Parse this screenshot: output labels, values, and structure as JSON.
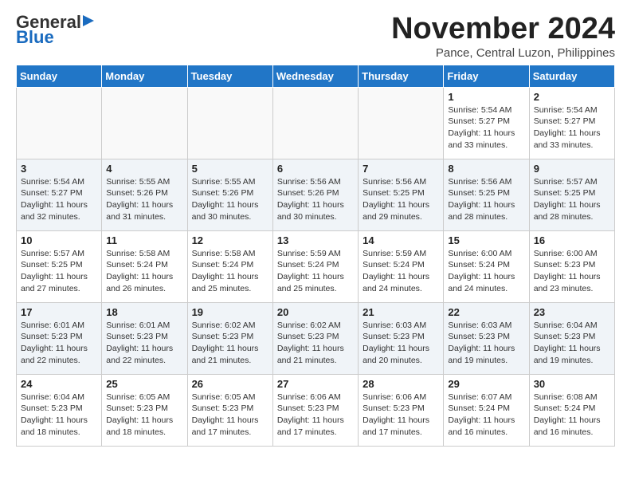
{
  "header": {
    "logo_general": "General",
    "logo_blue": "Blue",
    "month_title": "November 2024",
    "location": "Pance, Central Luzon, Philippines"
  },
  "weekdays": [
    "Sunday",
    "Monday",
    "Tuesday",
    "Wednesday",
    "Thursday",
    "Friday",
    "Saturday"
  ],
  "weeks": [
    [
      {
        "day": "",
        "info": ""
      },
      {
        "day": "",
        "info": ""
      },
      {
        "day": "",
        "info": ""
      },
      {
        "day": "",
        "info": ""
      },
      {
        "day": "",
        "info": ""
      },
      {
        "day": "1",
        "info": "Sunrise: 5:54 AM\nSunset: 5:27 PM\nDaylight: 11 hours\nand 33 minutes."
      },
      {
        "day": "2",
        "info": "Sunrise: 5:54 AM\nSunset: 5:27 PM\nDaylight: 11 hours\nand 33 minutes."
      }
    ],
    [
      {
        "day": "3",
        "info": "Sunrise: 5:54 AM\nSunset: 5:27 PM\nDaylight: 11 hours\nand 32 minutes."
      },
      {
        "day": "4",
        "info": "Sunrise: 5:55 AM\nSunset: 5:26 PM\nDaylight: 11 hours\nand 31 minutes."
      },
      {
        "day": "5",
        "info": "Sunrise: 5:55 AM\nSunset: 5:26 PM\nDaylight: 11 hours\nand 30 minutes."
      },
      {
        "day": "6",
        "info": "Sunrise: 5:56 AM\nSunset: 5:26 PM\nDaylight: 11 hours\nand 30 minutes."
      },
      {
        "day": "7",
        "info": "Sunrise: 5:56 AM\nSunset: 5:25 PM\nDaylight: 11 hours\nand 29 minutes."
      },
      {
        "day": "8",
        "info": "Sunrise: 5:56 AM\nSunset: 5:25 PM\nDaylight: 11 hours\nand 28 minutes."
      },
      {
        "day": "9",
        "info": "Sunrise: 5:57 AM\nSunset: 5:25 PM\nDaylight: 11 hours\nand 28 minutes."
      }
    ],
    [
      {
        "day": "10",
        "info": "Sunrise: 5:57 AM\nSunset: 5:25 PM\nDaylight: 11 hours\nand 27 minutes."
      },
      {
        "day": "11",
        "info": "Sunrise: 5:58 AM\nSunset: 5:24 PM\nDaylight: 11 hours\nand 26 minutes."
      },
      {
        "day": "12",
        "info": "Sunrise: 5:58 AM\nSunset: 5:24 PM\nDaylight: 11 hours\nand 25 minutes."
      },
      {
        "day": "13",
        "info": "Sunrise: 5:59 AM\nSunset: 5:24 PM\nDaylight: 11 hours\nand 25 minutes."
      },
      {
        "day": "14",
        "info": "Sunrise: 5:59 AM\nSunset: 5:24 PM\nDaylight: 11 hours\nand 24 minutes."
      },
      {
        "day": "15",
        "info": "Sunrise: 6:00 AM\nSunset: 5:24 PM\nDaylight: 11 hours\nand 24 minutes."
      },
      {
        "day": "16",
        "info": "Sunrise: 6:00 AM\nSunset: 5:23 PM\nDaylight: 11 hours\nand 23 minutes."
      }
    ],
    [
      {
        "day": "17",
        "info": "Sunrise: 6:01 AM\nSunset: 5:23 PM\nDaylight: 11 hours\nand 22 minutes."
      },
      {
        "day": "18",
        "info": "Sunrise: 6:01 AM\nSunset: 5:23 PM\nDaylight: 11 hours\nand 22 minutes."
      },
      {
        "day": "19",
        "info": "Sunrise: 6:02 AM\nSunset: 5:23 PM\nDaylight: 11 hours\nand 21 minutes."
      },
      {
        "day": "20",
        "info": "Sunrise: 6:02 AM\nSunset: 5:23 PM\nDaylight: 11 hours\nand 21 minutes."
      },
      {
        "day": "21",
        "info": "Sunrise: 6:03 AM\nSunset: 5:23 PM\nDaylight: 11 hours\nand 20 minutes."
      },
      {
        "day": "22",
        "info": "Sunrise: 6:03 AM\nSunset: 5:23 PM\nDaylight: 11 hours\nand 19 minutes."
      },
      {
        "day": "23",
        "info": "Sunrise: 6:04 AM\nSunset: 5:23 PM\nDaylight: 11 hours\nand 19 minutes."
      }
    ],
    [
      {
        "day": "24",
        "info": "Sunrise: 6:04 AM\nSunset: 5:23 PM\nDaylight: 11 hours\nand 18 minutes."
      },
      {
        "day": "25",
        "info": "Sunrise: 6:05 AM\nSunset: 5:23 PM\nDaylight: 11 hours\nand 18 minutes."
      },
      {
        "day": "26",
        "info": "Sunrise: 6:05 AM\nSunset: 5:23 PM\nDaylight: 11 hours\nand 17 minutes."
      },
      {
        "day": "27",
        "info": "Sunrise: 6:06 AM\nSunset: 5:23 PM\nDaylight: 11 hours\nand 17 minutes."
      },
      {
        "day": "28",
        "info": "Sunrise: 6:06 AM\nSunset: 5:23 PM\nDaylight: 11 hours\nand 17 minutes."
      },
      {
        "day": "29",
        "info": "Sunrise: 6:07 AM\nSunset: 5:24 PM\nDaylight: 11 hours\nand 16 minutes."
      },
      {
        "day": "30",
        "info": "Sunrise: 6:08 AM\nSunset: 5:24 PM\nDaylight: 11 hours\nand 16 minutes."
      }
    ]
  ]
}
